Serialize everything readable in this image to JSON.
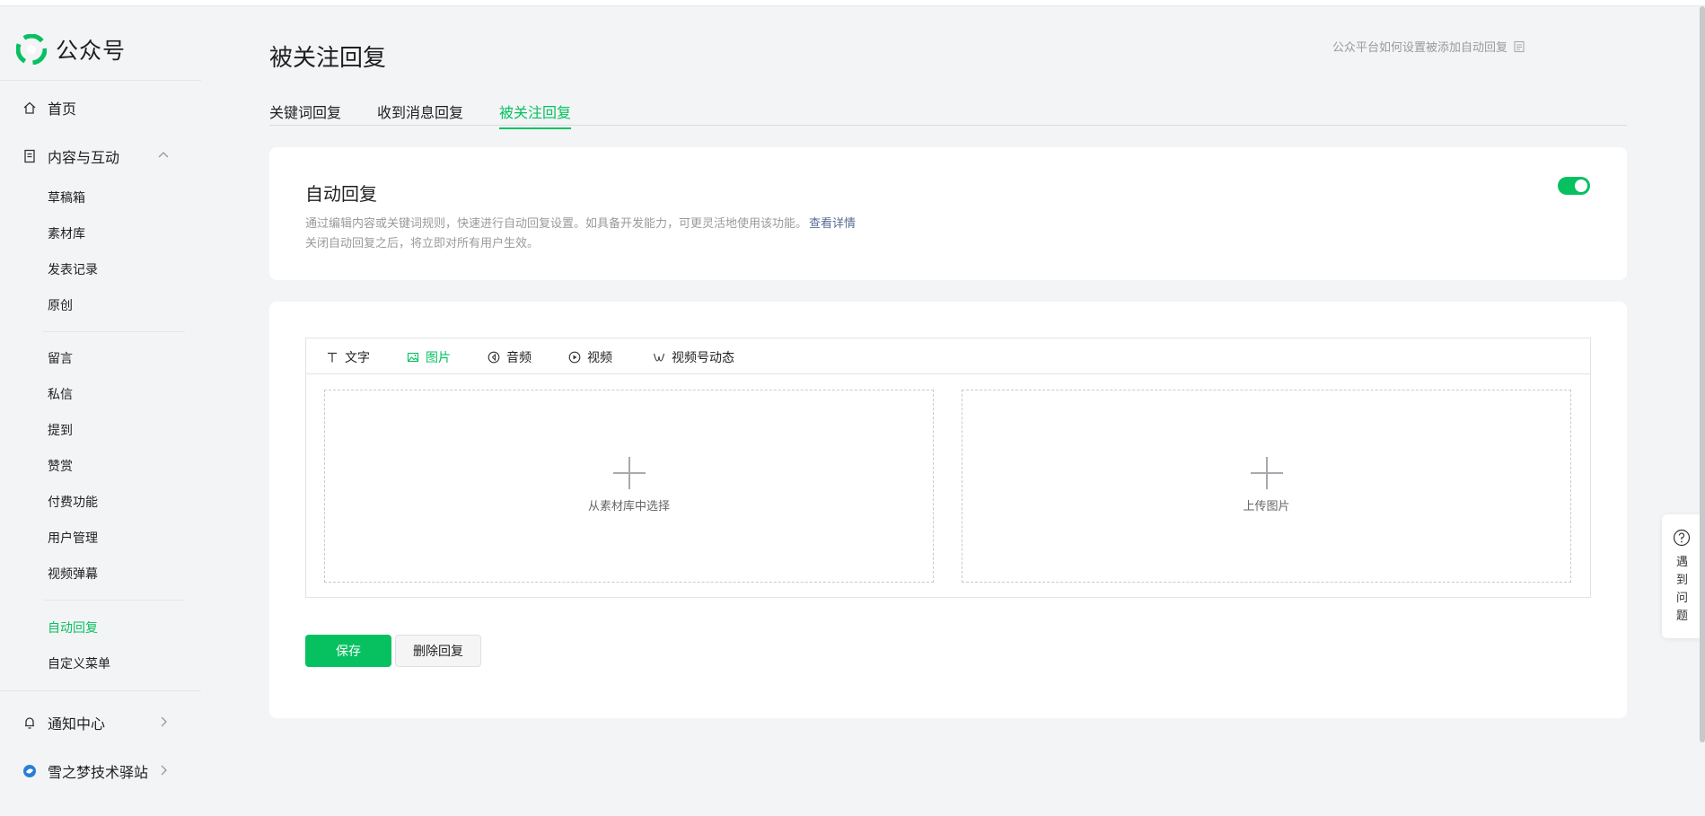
{
  "app": {
    "logo_text": "公众号"
  },
  "sidebar": {
    "home": "首页",
    "content_group": "内容与互动",
    "content_items": [
      "草稿箱",
      "素材库",
      "发表记录",
      "原创"
    ],
    "interaction_items": [
      "留言",
      "私信",
      "提到",
      "赞赏",
      "付费功能",
      "用户管理",
      "视频弹幕"
    ],
    "reply_items": [
      "自动回复",
      "自定义菜单"
    ],
    "active_item": "自动回复",
    "notification": "通知中心",
    "account": "雪之梦技术驿站"
  },
  "page": {
    "title": "被关注回复",
    "help_link": "公众平台如何设置被添加自动回复",
    "tabs": [
      "关键词回复",
      "收到消息回复",
      "被关注回复"
    ],
    "active_tab": "被关注回复"
  },
  "auto_reply": {
    "title": "自动回复",
    "desc_line1": "通过编辑内容或关键词规则，快速进行自动回复设置。如具备开发能力，可更灵活地使用该功能。",
    "desc_link": "查看详情",
    "desc_line2": "关闭自动回复之后，将立即对所有用户生效。",
    "enabled": true
  },
  "editor": {
    "tabs": [
      "文字",
      "图片",
      "音频",
      "视频",
      "视频号动态"
    ],
    "active_tab": "图片",
    "select_from_library": "从素材库中选择",
    "upload_image": "上传图片"
  },
  "actions": {
    "save": "保存",
    "delete": "删除回复"
  },
  "float_help": {
    "label": "遇到问题"
  },
  "colors": {
    "accent": "#07c160",
    "link": "#576b95",
    "background": "#f3f4f6"
  }
}
